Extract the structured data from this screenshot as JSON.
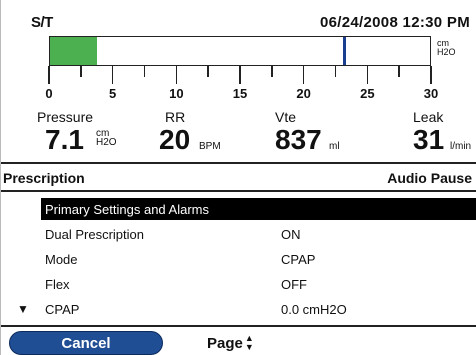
{
  "status": {
    "mode": "S/T",
    "datetime": "06/24/2008 12:30 PM"
  },
  "gauge": {
    "unit_line1": "cm",
    "unit_line2": "H2O",
    "scale_min": 0,
    "scale_max": 30,
    "fill_value": 3.7,
    "marker_value": 23.1,
    "fill_color": "#4caf50",
    "marker_color": "#1a3f8f",
    "tick_labels": [
      "0",
      "5",
      "10",
      "15",
      "20",
      "25",
      "30"
    ]
  },
  "readouts": [
    {
      "label": "Pressure",
      "value": "7.1",
      "unit_top": "cm",
      "unit_bottom": "H2O"
    },
    {
      "label": "RR",
      "value": "20",
      "unit": "BPM"
    },
    {
      "label": "Vte",
      "value": "837",
      "unit": "ml"
    },
    {
      "label": "Leak",
      "value": "31",
      "unit": "l/min"
    }
  ],
  "section": {
    "title": "Prescription",
    "audio_pause": "Audio Pause"
  },
  "menu": {
    "items": [
      {
        "name": "Primary Settings and Alarms",
        "value": "",
        "selected": true
      },
      {
        "name": "Dual Prescription",
        "value": "ON"
      },
      {
        "name": "Mode",
        "value": "CPAP"
      },
      {
        "name": "Flex",
        "value": "OFF"
      },
      {
        "name": "CPAP",
        "value": "0.0 cmH2O"
      }
    ]
  },
  "bottom": {
    "cancel_label": "Cancel",
    "page_label": "Page"
  }
}
